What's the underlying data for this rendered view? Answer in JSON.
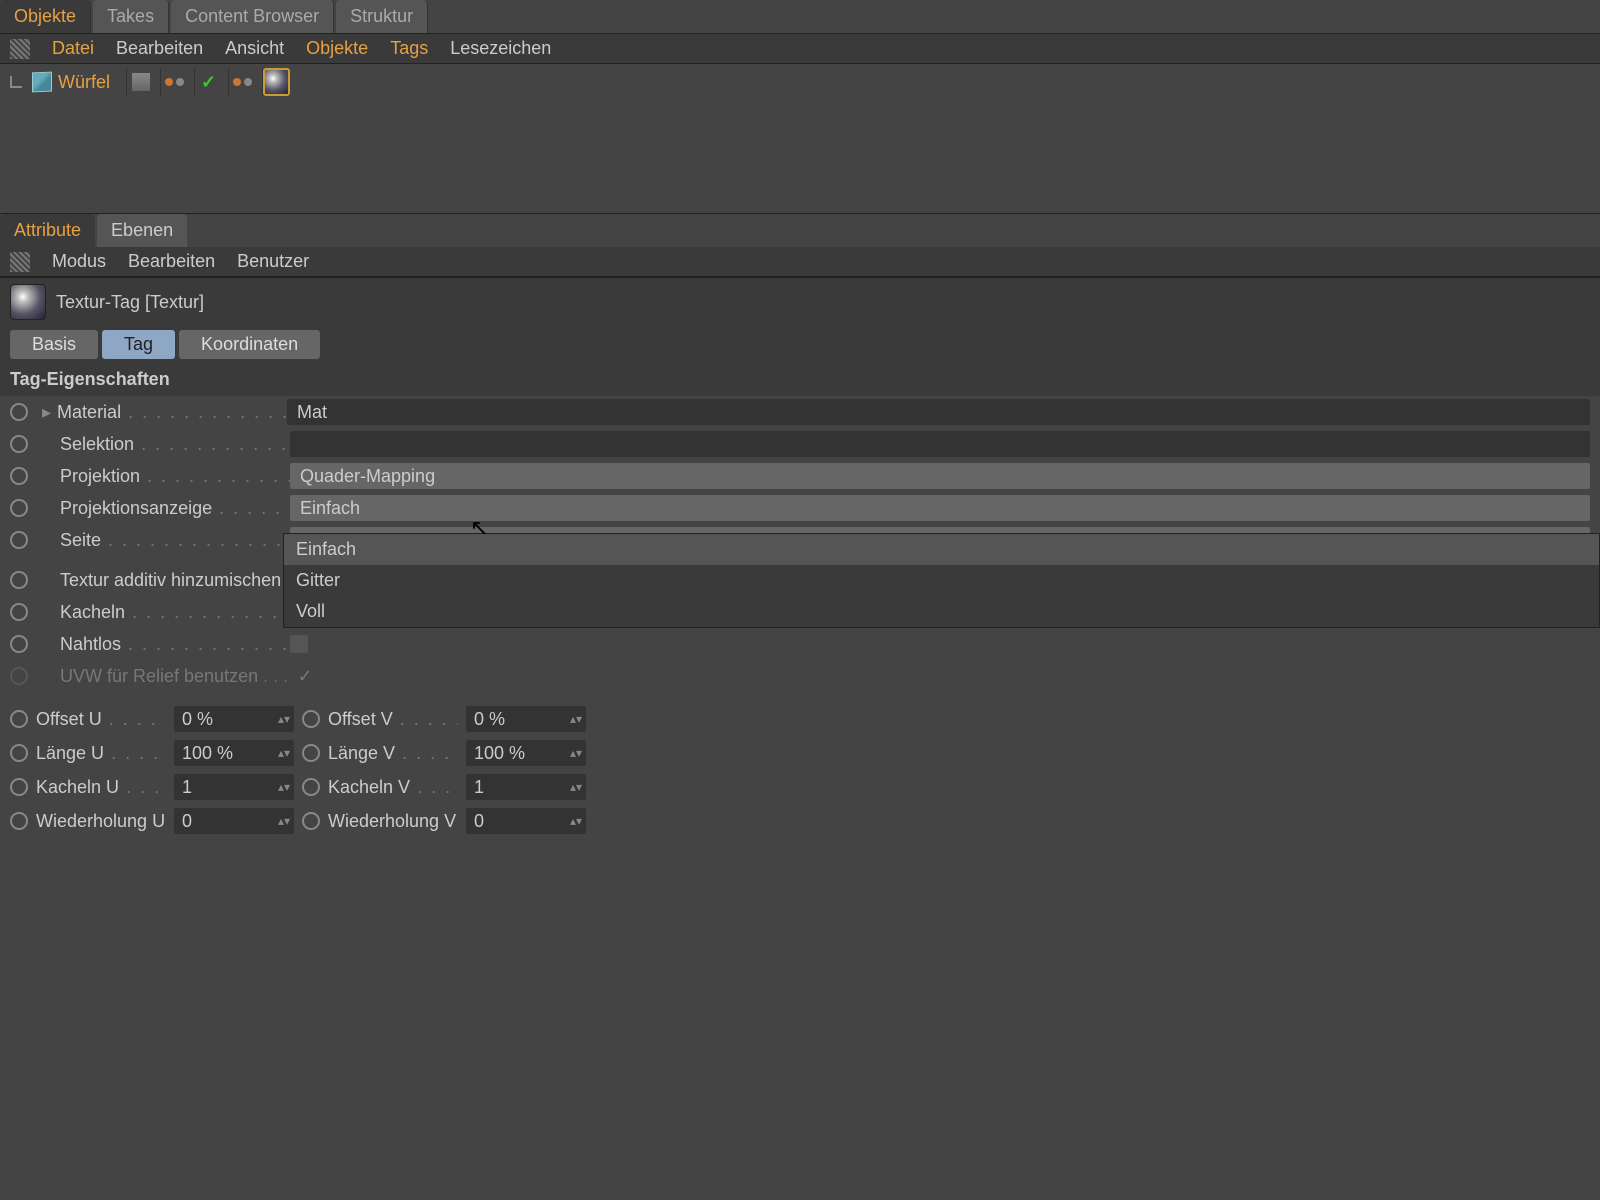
{
  "topTabs": {
    "objekte": "Objekte",
    "takes": "Takes",
    "contentBrowser": "Content Browser",
    "struktur": "Struktur"
  },
  "objMenu": {
    "datei": "Datei",
    "bearbeiten": "Bearbeiten",
    "ansicht": "Ansicht",
    "objekte": "Objekte",
    "tags": "Tags",
    "lesezeichen": "Lesezeichen"
  },
  "object": {
    "name": "Würfel"
  },
  "lowerTabs": {
    "attribute": "Attribute",
    "ebenen": "Ebenen"
  },
  "attrMenu": {
    "modus": "Modus",
    "bearbeiten": "Bearbeiten",
    "benutzer": "Benutzer"
  },
  "attrHeader": "Textur-Tag [Textur]",
  "attrTabs": {
    "basis": "Basis",
    "tag": "Tag",
    "koord": "Koordinaten"
  },
  "sectionTitle": "Tag-Eigenschaften",
  "props": {
    "material": {
      "label": "Material",
      "value": "Mat"
    },
    "selektion": {
      "label": "Selektion",
      "value": ""
    },
    "projektion": {
      "label": "Projektion",
      "value": "Quader-Mapping"
    },
    "projektionsanzeige": {
      "label": "Projektionsanzeige",
      "value": "Einfach"
    },
    "seite": {
      "label": "Seite",
      "value": ""
    },
    "texturAdd": {
      "label": "Textur additiv hinzumischen"
    },
    "kacheln": {
      "label": "Kacheln"
    },
    "nahtlos": {
      "label": "Nahtlos"
    },
    "uvwRelief": {
      "label": "UVW für Relief benutzen"
    }
  },
  "dropdown": {
    "opt1": "Einfach",
    "opt2": "Gitter",
    "opt3": "Voll"
  },
  "numProps": {
    "offsetU": {
      "label": "Offset U",
      "value": "0 %"
    },
    "offsetV": {
      "label": "Offset V",
      "value": "0 %"
    },
    "laengeU": {
      "label": "Länge U",
      "value": "100 %"
    },
    "laengeV": {
      "label": "Länge V",
      "value": "100 %"
    },
    "kachelnU": {
      "label": "Kacheln U",
      "value": "1"
    },
    "kachelnV": {
      "label": "Kacheln V",
      "value": "1"
    },
    "wiederU": {
      "label": "Wiederholung U",
      "value": "0"
    },
    "wiederV": {
      "label": "Wiederholung V",
      "value": "0"
    }
  }
}
